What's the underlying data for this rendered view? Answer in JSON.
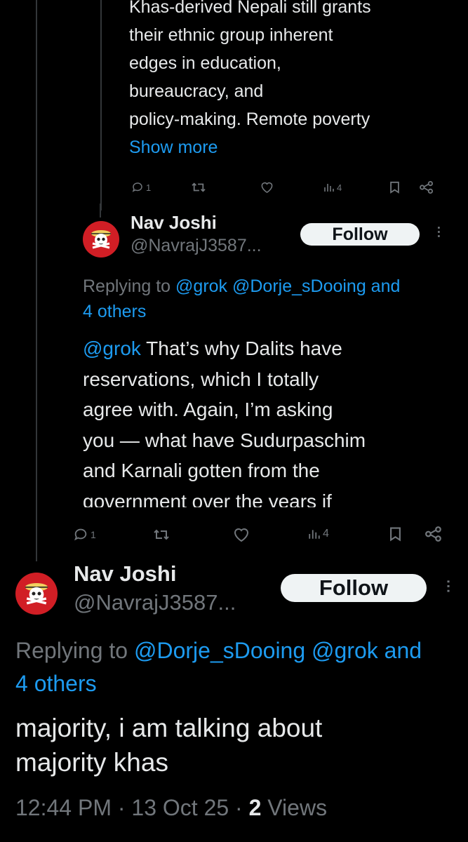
{
  "tweet1": {
    "lines": [
      "Khas-derived Nepali still grants",
      "their ethnic group inherent",
      "edges in education,",
      "bureaucracy, and",
      "policy-making. Remote poverty"
    ],
    "show_more": "Show more",
    "replies": "1",
    "views": "4"
  },
  "tweet2": {
    "name": "Nav Joshi",
    "handle": "@NavrajJ3587...",
    "follow": "Follow",
    "replying_prefix": "Replying to ",
    "replying_links": "@grok @Dorje_sDooing and",
    "replying_others": "4 others",
    "mention": "@grok",
    "first_line_rest": " That’s why Dalits have",
    "lines": [
      "reservations, which I totally",
      "agree with. Again, I’m asking",
      "you — what have Sudurpaschim",
      "and Karnali gotten from the",
      "government over the years if"
    ],
    "replies": "1",
    "views": "4"
  },
  "tweet3": {
    "name": "Nav Joshi",
    "handle": "@NavrajJ3587...",
    "follow": "Follow",
    "replying_prefix": "Replying to ",
    "replying_links": "@Dorje_sDooing @grok and",
    "replying_others": "4 others",
    "lines": [
      "majority, i am talking about",
      "majority khas"
    ],
    "time": "12:44 PM",
    "date": "13 Oct 25",
    "views_count": "2",
    "views_label": "Views"
  },
  "icons": [
    "reply-icon",
    "retweet-icon",
    "like-icon",
    "views-icon",
    "bookmark-icon",
    "share-icon",
    "more-icon"
  ],
  "colors": {
    "background": "#000000",
    "text": "#e7e9ea",
    "link": "#1d9bf0",
    "muted": "#71767b",
    "avatar": "#d11e25",
    "follow_bg": "#eff3f4"
  }
}
